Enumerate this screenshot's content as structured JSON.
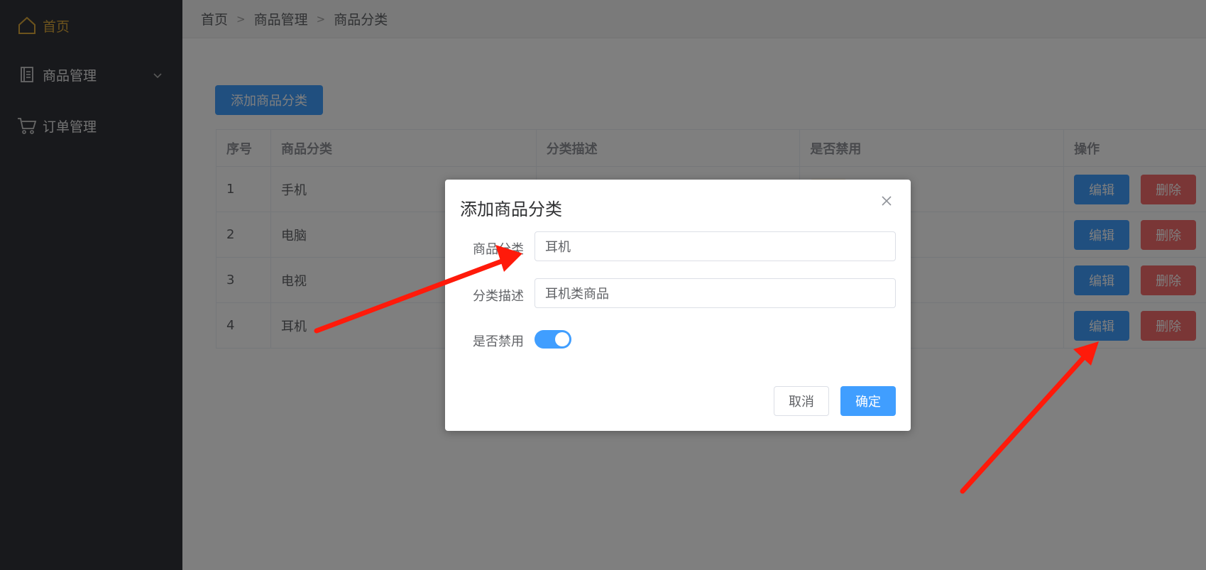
{
  "sidebar": {
    "items": [
      {
        "label": "首页",
        "icon": "home-icon"
      },
      {
        "label": "商品管理",
        "icon": "document-list-icon"
      },
      {
        "label": "订单管理",
        "icon": "cart-icon"
      }
    ],
    "active_color": "#d9a63b",
    "bg_color": "#303338"
  },
  "breadcrumb": {
    "items": [
      "首页",
      "商品管理",
      "商品分类"
    ]
  },
  "toolbar": {
    "add_label": "添加商品分类"
  },
  "table": {
    "headers": [
      "序号",
      "商品分类",
      "分类描述",
      "是否禁用",
      "操作"
    ],
    "rows": [
      {
        "index": "1",
        "name": "手机"
      },
      {
        "index": "2",
        "name": "电脑"
      },
      {
        "index": "3",
        "name": "电视"
      },
      {
        "index": "4",
        "name": "耳机"
      }
    ],
    "edit_label": "编辑",
    "delete_label": "删除"
  },
  "dialog": {
    "title": "添加商品分类",
    "fields": {
      "category_label": "商品分类",
      "category_value": "耳机",
      "desc_label": "分类描述",
      "desc_value": "耳机类商品",
      "disabled_label": "是否禁用",
      "disabled_on": true
    },
    "cancel_label": "取消",
    "confirm_label": "确定"
  },
  "colors": {
    "primary": "#409eff",
    "danger": "#f56c6c",
    "annotation": "#ff1a0a"
  }
}
